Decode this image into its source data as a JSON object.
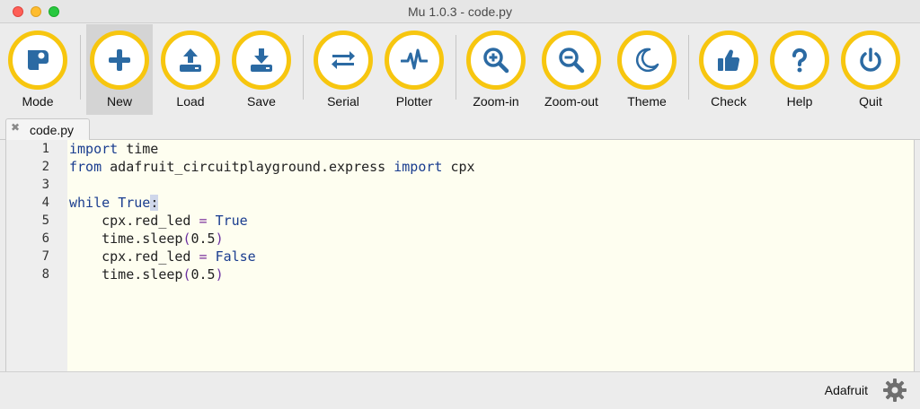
{
  "window": {
    "title": "Mu 1.0.3 - code.py"
  },
  "toolbar": {
    "buttons": [
      {
        "id": "mode",
        "label": "Mode",
        "icon": "mode-icon"
      },
      {
        "id": "new",
        "label": "New",
        "icon": "plus-icon",
        "active": true
      },
      {
        "id": "load",
        "label": "Load",
        "icon": "upload-icon"
      },
      {
        "id": "save",
        "label": "Save",
        "icon": "download-icon"
      },
      {
        "id": "serial",
        "label": "Serial",
        "icon": "swap-arrows-icon"
      },
      {
        "id": "plotter",
        "label": "Plotter",
        "icon": "pulse-icon"
      },
      {
        "id": "zoom-in",
        "label": "Zoom-in",
        "icon": "zoom-in-icon"
      },
      {
        "id": "zoom-out",
        "label": "Zoom-out",
        "icon": "zoom-out-icon"
      },
      {
        "id": "theme",
        "label": "Theme",
        "icon": "moon-icon"
      },
      {
        "id": "check",
        "label": "Check",
        "icon": "thumbs-up-icon"
      },
      {
        "id": "help",
        "label": "Help",
        "icon": "question-icon"
      },
      {
        "id": "quit",
        "label": "Quit",
        "icon": "power-icon"
      }
    ],
    "accent": "#f7c60f",
    "icon_color": "#2b6aa3"
  },
  "tabs": [
    {
      "name": "code.py",
      "close_symbol": "✖"
    }
  ],
  "editor": {
    "lines": [
      {
        "no": "1",
        "text": "import time"
      },
      {
        "no": "2",
        "text": "from adafruit_circuitplayground.express import cpx"
      },
      {
        "no": "3",
        "text": ""
      },
      {
        "no": "4",
        "text": "while True:"
      },
      {
        "no": "5",
        "text": "    cpx.red_led = True"
      },
      {
        "no": "6",
        "text": "    time.sleep(0.5)"
      },
      {
        "no": "7",
        "text": "    cpx.red_led = False"
      },
      {
        "no": "8",
        "text": "    time.sleep(0.5)"
      }
    ]
  },
  "statusbar": {
    "mode": "Adafruit",
    "icon": "gear-icon"
  }
}
